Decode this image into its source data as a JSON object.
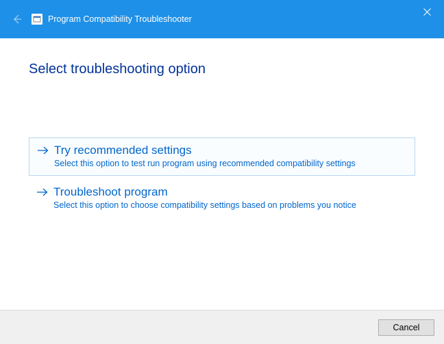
{
  "titlebar": {
    "title": "Program Compatibility Troubleshooter"
  },
  "page": {
    "heading": "Select troubleshooting option"
  },
  "options": [
    {
      "title": "Try recommended settings",
      "desc": "Select this option to test run program using recommended compatibility settings"
    },
    {
      "title": "Troubleshoot program",
      "desc": "Select this option to choose compatibility settings based on problems you notice"
    }
  ],
  "footer": {
    "cancel": "Cancel"
  }
}
